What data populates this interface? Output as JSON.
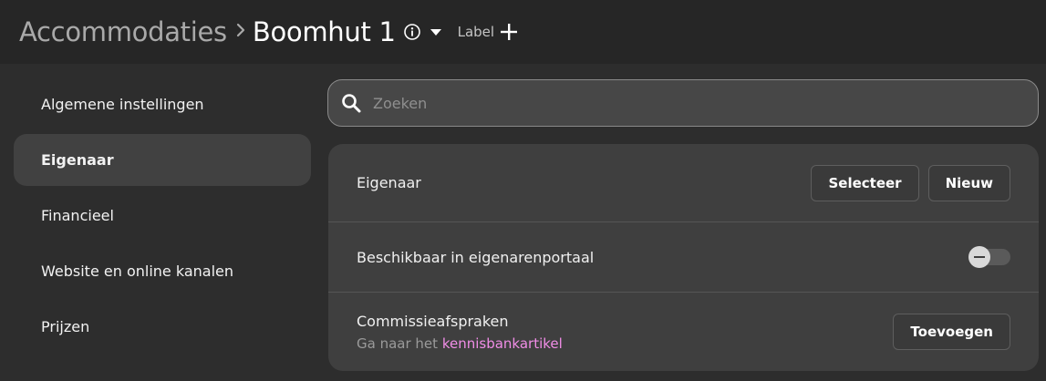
{
  "header": {
    "breadcrumb_parent": "Accommodaties",
    "separator": "›",
    "title": "Boomhut 1",
    "label_button": "Label"
  },
  "sidebar": {
    "items": [
      {
        "label": "Algemene instellingen",
        "active": false
      },
      {
        "label": "Eigenaar",
        "active": true
      },
      {
        "label": "Financieel",
        "active": false
      },
      {
        "label": "Website en online kanalen",
        "active": false
      },
      {
        "label": "Prijzen",
        "active": false
      }
    ]
  },
  "search": {
    "placeholder": "Zoeken",
    "value": ""
  },
  "card": {
    "owner_row": {
      "label": "Eigenaar",
      "select_button": "Selecteer",
      "new_button": "Nieuw"
    },
    "portal_row": {
      "label": "Beschikbaar in eigenarenportaal",
      "toggle_state": "indeterminate"
    },
    "commission_row": {
      "label": "Commissieafspraken",
      "hint_prefix": "Ga naar het",
      "hint_link": "kennisbankartikel",
      "add_button": "Toevoegen"
    }
  },
  "colors": {
    "header_bg": "#262626",
    "page_bg": "#2d2d2d",
    "card_bg": "#3f3f3f",
    "link": "#f08de6"
  },
  "icons": [
    "info-icon",
    "caret-down-icon",
    "plus-icon",
    "search-icon"
  ]
}
